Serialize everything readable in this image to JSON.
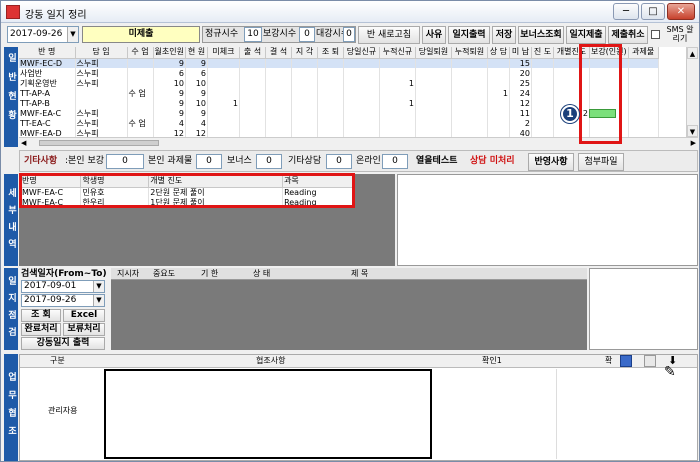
{
  "window": {
    "title": "강동 일지 정리",
    "btn_min": "─",
    "btn_max": "□",
    "btn_close": "✕"
  },
  "toolbar": {
    "date": "2017-09-26",
    "status": "미제출",
    "reg_label": "정규시수",
    "reg_value": "10",
    "sup_label": "보강시수",
    "sup_value": "0",
    "sub_label": "대강시수",
    "sub_value": "0",
    "refresh": "반 새로고침",
    "btn_reason": "사유",
    "btn_print": "일지출력",
    "btn_save": "저장",
    "btn_bonus": "보너스조회",
    "btn_submit": "일지제출",
    "btn_cancel": "제출취소",
    "sms_label": "SMS 알리기"
  },
  "section_ilban": "일반현황",
  "ilban_headers": [
    "반 명",
    "담 임",
    "수 업",
    "월초인원",
    "현 원",
    "미체크",
    "출 석",
    "결 석",
    "지 각",
    "조 퇴",
    "당일신규",
    "누적신규",
    "당일퇴원",
    "누적퇴원",
    "상 담",
    "미 납",
    "진 도",
    "개별진도",
    "보강(인원)",
    "과제물"
  ],
  "ilban_rows": [
    [
      "MWF-EC-D",
      "스누피",
      "",
      "9",
      "9",
      "",
      "",
      "",
      "",
      "",
      "",
      "",
      "",
      "",
      "",
      "15",
      "",
      "",
      "",
      ""
    ],
    [
      "사업반",
      "스누피",
      "",
      "6",
      "6",
      "",
      "",
      "",
      "",
      "",
      "",
      "",
      "",
      "",
      "",
      "20",
      "",
      "",
      "",
      ""
    ],
    [
      "기획운영반",
      "스누피",
      "",
      "10",
      "10",
      "",
      "",
      "",
      "",
      "",
      "",
      "1",
      "",
      "",
      "",
      "25",
      "",
      "",
      "",
      ""
    ],
    [
      "TT-AP-A",
      "",
      "수 업",
      "9",
      "9",
      "",
      "",
      "",
      "",
      "",
      "",
      "",
      "",
      "",
      "1",
      "24",
      "",
      "",
      "",
      ""
    ],
    [
      "TT-AP-B",
      "",
      "",
      "9",
      "10",
      "1",
      "",
      "",
      "",
      "",
      "",
      "1",
      "",
      "",
      "",
      "12",
      "",
      "",
      "",
      ""
    ],
    [
      "MWF-EA-C",
      "스누피",
      "",
      "9",
      "9",
      "",
      "",
      "",
      "",
      "",
      "",
      "",
      "",
      "",
      "",
      "11",
      "",
      "2",
      "",
      ""
    ],
    [
      "TT-EA-C",
      "스누피",
      "수 업",
      "4",
      "4",
      "",
      "",
      "",
      "",
      "",
      "",
      "",
      "",
      "",
      "",
      "2",
      "",
      "",
      "",
      ""
    ],
    [
      "MWF-EA-D",
      "스누피",
      "",
      "12",
      "12",
      "",
      "",
      "",
      "",
      "",
      "",
      "",
      "",
      "",
      "",
      "40",
      "",
      "",
      "",
      ""
    ]
  ],
  "marker_label": "1",
  "etc": {
    "label": "기타사항",
    "self_sup_label": ":본인 보강",
    "self_sup_value": "0",
    "self_hw_label": "본인 과제물",
    "self_hw_value": "0",
    "bonus_label": "보너스",
    "bonus_value": "0",
    "other_label": "기타상담",
    "other_value": "0",
    "online_label": "온라인",
    "online_value": "0",
    "test_label": "열을테스트",
    "consult_label": "상담 미처리",
    "btn_reflect": "반영사항",
    "btn_attach": "첨부파일"
  },
  "section_detail": "세부내역",
  "detail_headers": [
    "반명",
    "학생명",
    "개별 진도",
    "과목"
  ],
  "detail_rows": [
    [
      "MWF-EA-C",
      "민유호",
      "2단원 문제 풀이",
      "Reading"
    ],
    [
      "MWF-EA-C",
      "한우리",
      "1단원 문제 풀이",
      "Reading"
    ]
  ],
  "section_check": "일지점검",
  "check": {
    "range_label": "검색일자(From~To)",
    "from": "2017-09-01",
    "to": "2017-09-26",
    "btn_query": "조 회",
    "btn_excel": "Excel",
    "btn_done": "완료처리",
    "btn_hold": "보류처리",
    "btn_print": "강동일지 출력",
    "headers": [
      "지시자",
      "중요도",
      "기 한",
      "상 태",
      "제 목"
    ]
  },
  "section_coop": "업무협조",
  "coop": {
    "headers": [
      "구분",
      "협조사항",
      "확인1",
      "확"
    ],
    "row_label": "관리자용"
  },
  "colors": {
    "sidebar": "#1e5aa8",
    "highlight": "#e01515",
    "progress": "#7be07b",
    "status_bg": "#ffffc0"
  }
}
